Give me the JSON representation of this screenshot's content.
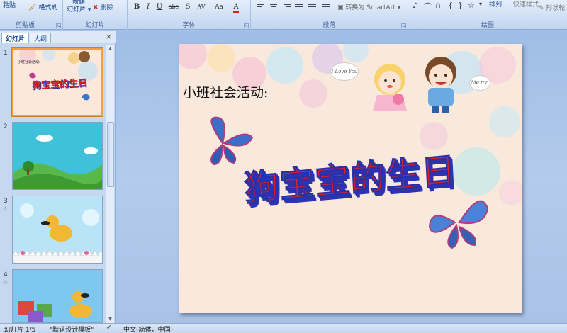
{
  "ribbon": {
    "clipboard": {
      "paste": "粘贴",
      "format_painter": "格式刷",
      "label": "剪贴板"
    },
    "slides": {
      "new_slide_line1": "新建",
      "new_slide_line2": "幻灯片",
      "delete": "删除",
      "label": "幻灯片"
    },
    "font": {
      "bold": "B",
      "italic": "I",
      "underline": "U",
      "strike": "abe",
      "shadow": "S",
      "spacing": "AV",
      "case": "Aa",
      "label": "字体"
    },
    "paragraph": {
      "smartart": "转换为 SmartArt",
      "label": "段落"
    },
    "drawing": {
      "arrange": "排列",
      "quick_styles": "快速样式",
      "shape_outline": "形状轮",
      "label": "绘图"
    }
  },
  "left_panel": {
    "tabs": [
      "幻灯片",
      "大纲"
    ],
    "close_glyph": "×",
    "slides": [
      {
        "number": "1",
        "title": "狗宝宝的生日",
        "subtitle": "小班社会活动:"
      },
      {
        "number": "2"
      },
      {
        "number": "3"
      },
      {
        "number": "4"
      }
    ]
  },
  "slide": {
    "subtitle": "小班社会活动:",
    "title": "狗宝宝的生日",
    "bubble_left": "I Love You",
    "bubble_right": "Me too"
  },
  "status": {
    "slide_counter": "幻灯片 1/5",
    "theme": "\"默认设计模板\"",
    "language": "中文(简体，中国)"
  },
  "colors": {
    "title_red": "#e22020",
    "title_outline": "#2d33b0",
    "ribbon_text": "#15428b",
    "slide_bg": "#f8e9dc"
  }
}
